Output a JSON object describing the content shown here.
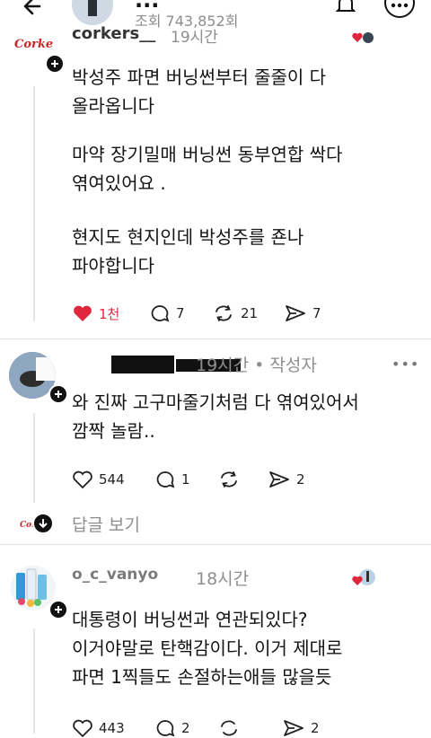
{
  "header": {
    "title": "...",
    "views_label": "조회 743,852회"
  },
  "comments": [
    {
      "username": "corkers__",
      "time": "19시간",
      "paragraphs": [
        "박성주 파면 버닝썬부터 줄줄이 다\n올라옵니다",
        "마약 장기밀매 버닝썬 동부연합 싹다\n엮여있어요 .",
        "현지도 현지인데 박성주를 죤나\n파야합니다"
      ],
      "likes": "1천",
      "replies": "7",
      "reposts": "21",
      "shares": "7",
      "liked": true
    },
    {
      "username": "▪▪▪▪ ▪▪▪",
      "time": "19시간 • 작성자",
      "paragraphs": [
        "와 진짜 고구마줄기처럼 다 엮여있어서\n깜짝 놀람.."
      ],
      "likes": "544",
      "replies": "1",
      "reposts": "",
      "shares": "2",
      "liked": false
    },
    {
      "username": "o_c_vanyo",
      "time": "18시간",
      "paragraphs": [
        "대통령이 버닝썬과 연관되있다?\n이거야말로 탄핵감이다. 이거 제대로\n파면 1찍들도 손절하는애들 많을듯"
      ],
      "likes": "443",
      "replies": "2",
      "reposts": "",
      "shares": "2",
      "liked": false
    }
  ],
  "view_replies_label": "답글 보기",
  "colors": {
    "like_red": "#e0263c",
    "text": "#141414",
    "muted": "#8e8e8e"
  }
}
